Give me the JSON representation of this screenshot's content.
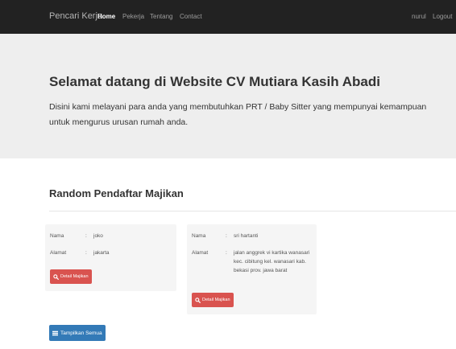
{
  "navbar": {
    "brand": "Pencari Kerja",
    "links": [
      "Home",
      "Pekerja",
      "Tentang",
      "Contact"
    ],
    "user": "nurul",
    "logout": "Logout"
  },
  "hero": {
    "title": "Selamat datang di Website CV Mutiara Kasih Abadi",
    "text": "Disini kami melayani para anda yang membutuhkan PRT / Baby Sitter yang mempunyai kemampuan untuk mengurus urusan rumah anda."
  },
  "section": {
    "title": "Random Pendaftar Majikan"
  },
  "cards": [
    {
      "nama_label": "Nama",
      "nama": "joko",
      "alamat_label": "Alamat",
      "alamat": "jakarta",
      "button": "Detail Majikan"
    },
    {
      "nama_label": "Nama",
      "nama": "sri hartanti",
      "alamat_label": "Alamat",
      "alamat": "jalan anggrek vi kartika wanasari kec. cibitung kel. wanasari kab. bekasi prov. jawa barat",
      "button": "Detail Majikan"
    }
  ],
  "separator": ":",
  "show_all_button": "Tampilkan Semua",
  "colors": {
    "navbar": "#222222",
    "jumbotron": "#eeeeee",
    "danger": "#d9534f",
    "primary": "#337ab7"
  },
  "icons": {
    "detail": "search-icon",
    "show_all": "list-icon"
  }
}
